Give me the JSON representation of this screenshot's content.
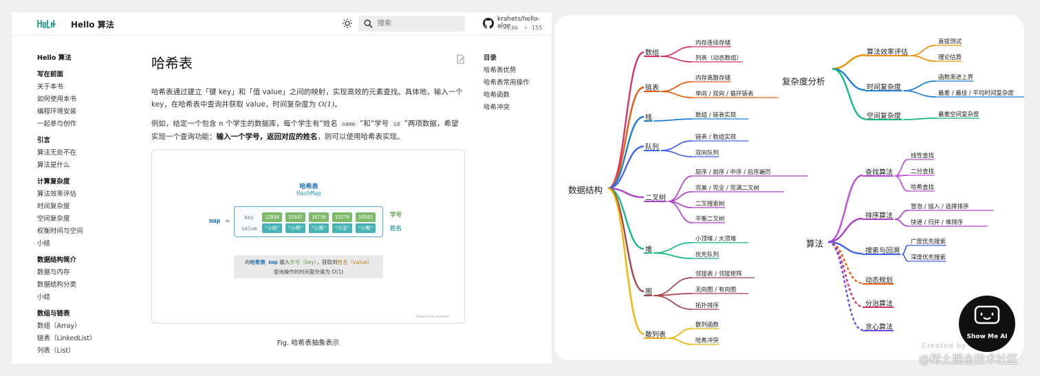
{
  "header": {
    "site_title": "Hello 算法",
    "search_placeholder": "搜索",
    "repo_name": "krahets/hello-algo",
    "stars": "1.6k",
    "forks": "155"
  },
  "sidebar": {
    "items": [
      {
        "label": "Hello 算法",
        "head": true
      },
      {
        "label": "",
        "gap": true
      },
      {
        "label": "写在前面",
        "head": true
      },
      {
        "label": "关于本书"
      },
      {
        "label": "如何使用本书"
      },
      {
        "label": "编程环境安装"
      },
      {
        "label": "一起参与创作"
      },
      {
        "label": "",
        "gap": true
      },
      {
        "label": "引言",
        "head": true
      },
      {
        "label": "算法无处不在"
      },
      {
        "label": "算法是什么"
      },
      {
        "label": "",
        "gap": true
      },
      {
        "label": "计算复杂度",
        "head": true
      },
      {
        "label": "算法效率评估"
      },
      {
        "label": "时间复杂度"
      },
      {
        "label": "空间复杂度"
      },
      {
        "label": "权衡时间与空间"
      },
      {
        "label": "小结"
      },
      {
        "label": "",
        "gap": true
      },
      {
        "label": "数据结构简介",
        "head": true
      },
      {
        "label": "数据与内存"
      },
      {
        "label": "数据结构分类"
      },
      {
        "label": "小结"
      },
      {
        "label": "",
        "gap": true
      },
      {
        "label": "数组与链表",
        "head": true
      },
      {
        "label": "数组（Array）"
      },
      {
        "label": "链表（LinkedList）"
      },
      {
        "label": "列表（List）"
      }
    ]
  },
  "content": {
    "title": "哈希表",
    "p1_a": "哈希表通过建立「键 key」和「值 value」之间的映射，实现高效的元素查找。具体地，输入一个 key，在哈希表中查询并获取 value，时间复杂度为 ",
    "p1_math": "O(1)",
    "p1_b": "。",
    "p2_a": "例如，给定一个包含 ",
    "p2_math": "n",
    "p2_b": " 个学生的数据库，每个学生有“姓名 ",
    "p2_code1": "name",
    "p2_c": " ”和“学号 ",
    "p2_code2": "id",
    "p2_d": " ”两项数据，希望实现一个查询功能：",
    "p2_bold": "输入一个学号，返回对应的姓名",
    "p2_e": "，则可以使用哈希表实现。",
    "caption": "Fig. 哈希表抽象表示"
  },
  "figure": {
    "title": "哈希表",
    "subtitle": "HashMap",
    "map_label": "map",
    "map_eq": "=",
    "key_label": "key",
    "value_label": "value",
    "keys": [
      "12836",
      "15937",
      "16750",
      "13276",
      "10583"
    ],
    "values": [
      "“小哈”",
      "“小啰”",
      "“小算”",
      "“小法”",
      "“小鸭”"
    ],
    "side_key": "学号",
    "side_value": "姓名",
    "query_a": "向",
    "query_b": "哈希表 map",
    "query_c": " 输入",
    "query_d": "学号（key）",
    "query_e": "，获取到",
    "query_f": "姓名（value）",
    "query_line2": "查询操作的时间复杂度为 O(1)",
    "credit": "Created by krahets"
  },
  "toc": {
    "title": "目录",
    "items": [
      "哈希表优势",
      "哈希表常用操作",
      "哈希函数",
      "哈希冲突"
    ]
  },
  "mindmap": {
    "root_ds": "数据结构",
    "ds": [
      {
        "label": "数组",
        "leaves": [
          "内存连续存储",
          "列表（动态数组）"
        ],
        "color": "#d6336c"
      },
      {
        "label": "链表",
        "leaves": [
          "内存离散存储",
          "单向 / 双向 / 循环链表"
        ],
        "color": "#e8590c"
      },
      {
        "label": "栈",
        "leaves": [
          "数组 / 链表实现"
        ],
        "color": "#1c7ed6"
      },
      {
        "label": "队列",
        "leaves": [
          "链表 / 数组实现",
          "双向队列"
        ],
        "color": "#4263eb"
      },
      {
        "label": "二叉树",
        "leaves": [
          "层序 / 前序 / 中序 / 后序遍历",
          "完美 / 完全 / 完满二叉树",
          "二叉搜索树",
          "平衡二叉树"
        ],
        "color": "#ae3ec9"
      },
      {
        "label": "堆",
        "leaves": [
          "小顶堆 / 大顶堆",
          "优先队列"
        ],
        "color": "#12b886"
      },
      {
        "label": "图",
        "leaves": [
          "邻接表 / 邻接矩阵",
          "无向图 / 有向图",
          "拓扑排序"
        ],
        "color": "#a5424a"
      },
      {
        "label": "散列表",
        "leaves": [
          "散列函数",
          "哈希冲突"
        ],
        "color": "#f0b400"
      }
    ],
    "root_cx": "复杂度分析",
    "cx": [
      {
        "label": "算法效率评估",
        "leaves": [
          "直接测试",
          "理论估算"
        ],
        "color": "#f08c00"
      },
      {
        "label": "时间复杂度",
        "leaves": [
          "函数渐进上界",
          "最差 / 最佳 / 平均时间复杂度"
        ],
        "color": "#1c7ed6"
      },
      {
        "label": "空间复杂度",
        "leaves": [
          "最差空间复杂度"
        ],
        "color": "#12b886"
      }
    ],
    "root_alg": "算法",
    "alg": [
      {
        "label": "查找算法",
        "leaves": [
          "线性查找",
          "二分查找",
          "哈希查找"
        ],
        "color": "#be4bdb"
      },
      {
        "label": "排序算法",
        "leaves": [
          "冒泡 / 插入 / 选择排序",
          "快速 / 归并 / 堆排序"
        ],
        "color": "#ae3ec9"
      },
      {
        "label": "搜索与回溯",
        "leaves": [
          "广度优先搜索",
          "深度优先搜索"
        ],
        "color": "#4263eb"
      },
      {
        "label": "动态规划",
        "leaves": [],
        "color": "#e8590c"
      },
      {
        "label": "分治算法",
        "leaves": [],
        "color": "#d6336c"
      },
      {
        "label": "贪心算法",
        "leaves": [],
        "color": "#7048e8"
      }
    ],
    "credit": "Created by"
  },
  "badge": {
    "text": "Show Me AI"
  },
  "watermark": "@稀土掘金技术社区"
}
